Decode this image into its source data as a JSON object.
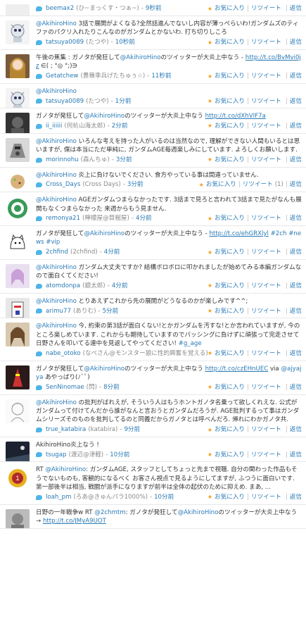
{
  "actions": {
    "favorite": "お気に入り",
    "retweet": "リツイート",
    "reply": "返信"
  },
  "colors": {
    "link": "#2a7ab5",
    "meta": "#8a8a8a",
    "bird": "#4db5e8"
  },
  "tweets": [
    {
      "parts": [
        "",
        "",
        ""
      ],
      "user": "beemax2",
      "display": "(ひ~まっくす・つぁ~)",
      "time": "9秒前",
      "avatar": "blank",
      "rt": ""
    },
    {
      "parts": [
        "",
        "@AkihiroHino",
        " 3話で展開がよくなる?全然話進んでないし内容が薄っぺらいわ!ガンダムズのティファのパクリ入れたりこんなのがガンダムとかないわ. 打ち切りしころ"
      ],
      "user": "tatsuya0089",
      "display": "(たつや)",
      "time": "10秒前",
      "avatar": "robot",
      "rt": ""
    },
    {
      "parts": [
        "午後の蕉集 : ガノタが発狂して",
        "@AkihiroHino",
        "のツイッターが大炎上中なう - http://t.co/BvMvi0jz ∈( ; °◎ °;)∋"
      ],
      "user": "Getatchew",
      "display": "(豊穣季兵げたちゅぅ☆)",
      "time": "11秒前",
      "avatar": "girl",
      "rt": ""
    },
    {
      "parts": [
        "",
        "@AkihiroHino",
        ""
      ],
      "user": "tatsuya0089",
      "display": "(たつや)",
      "time": "1分前",
      "avatar": "robot",
      "rt": ""
    },
    {
      "parts": [
        "ガノタが発狂して",
        "@AkihiroHino",
        "のツイッターが大炎上中なう http://t.co/dXhVIF7a"
      ],
      "user": "ii_iiiiii",
      "display": "(何処山海太郎)",
      "time": "2分前",
      "avatar": "dark",
      "rt": ""
    },
    {
      "parts": [
        "",
        "@AkihiroHino",
        " いろんな考えを持った人がいるのは当然なので, 理解ができない人間もいるとは思いますが, 僕は本当にただ単純に, ガンダムAGE毎週楽しみにしています. よろしくお願いします."
      ],
      "user": "morinnohu",
      "display": "(森んちゅ)",
      "time": "3分前",
      "avatar": "mecha",
      "rt": ""
    },
    {
      "parts": [
        "",
        "@AkihiroHino",
        " 炎上に負けないでください. 食方やっている事は間違っていません."
      ],
      "user": "Cross_Days",
      "display": "(Cross Days)",
      "time": "3分前",
      "avatar": "cookie",
      "rt": "(1)"
    },
    {
      "parts": [
        "",
        "@AkihiroHino",
        " AGEガンダムつまらなかったです. 3話まで見ろと言われて3話まで見たがなんも展開もなくつまらなかった 来週からもう見ません."
      ],
      "user": "remonya21",
      "display": "(檸檬屋@質樹屋)",
      "time": "4分前",
      "avatar": "green",
      "rt": ""
    },
    {
      "parts": [
        "ガノタが発狂して",
        "@AkihiroHino",
        "のツイッターが大炎上中なう - http://t.co/ehGRXlyl #2ch #news #vip"
      ],
      "user": "2chfind",
      "display": "(2chfind)",
      "time": "4分前",
      "avatar": "cat",
      "rt": ""
    },
    {
      "parts": [
        "",
        "@AkihiroHino",
        " ガンダム大丈夫ですか?  結構ボロボロに叩かれましたが始めてみる本編ガンダムなので面白くてください!"
      ],
      "user": "atomdonpa",
      "display": "(銀太郎)",
      "time": "4分前",
      "avatar": "anime",
      "rt": ""
    },
    {
      "parts": [
        "",
        "@AkihiroHino",
        " とりあえずこれから先の展開がどうなるのかが楽しみです^^;"
      ],
      "user": "arimu77",
      "display": "(ありむ)",
      "time": "5分前",
      "avatar": "gundam",
      "rt": ""
    },
    {
      "parts": [
        "",
        "@AkihiroHino",
        " 今, 約束の第3話が面白くない!とかガンダムを汚すな!とか言われていますが, 今のところ楽しめています. これからも期待していますのでバッシングに負けずに頑張って完走させて日野さんを叩いてる連中を見返してやってください! #g_age"
      ],
      "user": "nabe_otoko",
      "display": "(なべさん@モンスター狼に性的興奮を覚える)",
      "time": "6分前",
      "avatar": "brown",
      "rt": ""
    },
    {
      "parts": [
        "ガノタが発狂して",
        "@AkihiroHino",
        "のツイッターが大炎上中なう http://t.co/czEHnUEC via @ajyajya あやっぱり(ﾉ`ﾟ)"
      ],
      "user": "SenNinomae",
      "display": "(閃)",
      "time": "8分前",
      "avatar": "red",
      "rt": ""
    },
    {
      "parts": [
        "",
        "@AkihiroHino",
        " の批判がばれえが, そういう人はもうホントガノタ名乗って欲しくれえな. 公式がガンダムって付けてんだから誰がなんと言おうとガンダムだろうが. AGE批判するって事はガンダムシリーズそのものを批判してるのと同義だからガノタとは呼べんだろ. 帰れにわかガノタ共."
      ],
      "user": "true_katabira",
      "display": "(katabira)",
      "time": "9分前",
      "avatar": "sketch",
      "rt": ""
    },
    {
      "parts": [
        "AkihiroHino炎上なう !",
        "",
        ""
      ],
      "user": "tsugap",
      "display": "(渡辺@津軽)",
      "time": "10分前",
      "avatar": "night",
      "rt": ""
    },
    {
      "parts": [
        "RT ",
        "@AkihiroHino",
        ": ガンダムAGE, スタッフとしてちょっと先まで視聴. 自分の関わった作品もそうでないものも, 客観的になるべく お客さん視点で見るようにしてますが, ふつうに面白いです. 第一部後半は相当, 戦闘が派手になりますが前半は全体の起伏のために抑えめ. まあ, ..."
      ],
      "user": "loah_pm",
      "display": "(ろあ@きゅんパラ1000%)",
      "time": "10分前",
      "avatar": "gold",
      "rt": ""
    },
    {
      "parts": [
        "日野の一年戦争w RT @2chmtm: ガノタが発狂して",
        "@AkihiroHino",
        "のツイッターが大炎上中なう→ http://t.co/JMyA9UOT"
      ],
      "user": "",
      "display": "",
      "time": "",
      "avatar": "photo",
      "rt": ""
    }
  ]
}
